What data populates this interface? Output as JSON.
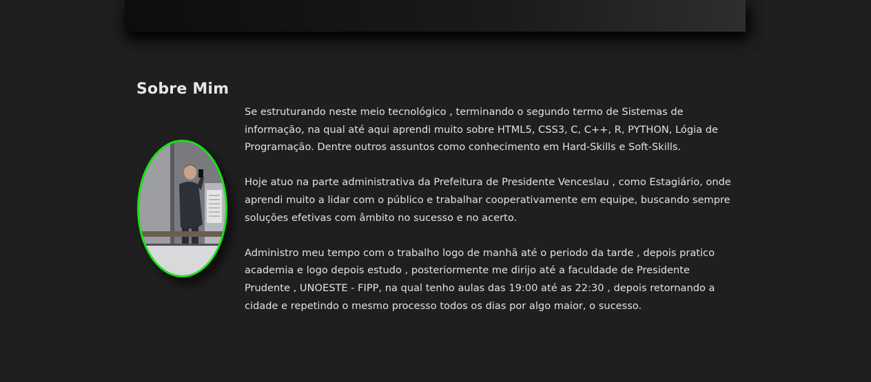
{
  "banner": {
    "gradient_start": "#0d0d0d",
    "gradient_end": "#2e2e2e"
  },
  "about": {
    "title": "Sobre Mim",
    "avatar_icon": "person-photo",
    "avatar_border_color": "#14e614",
    "paragraphs": [
      "Se estruturando neste meio tecnológico , terminando o segundo termo de Sistemas de informação, na qual até aqui aprendi muito sobre HTML5, CSS3, C, C++, R, PYTHON, Lógia de Programação. Dentre outros assuntos como conhecimento em Hard-Skills e Soft-Skills.",
      "Hoje atuo na parte administrativa da Prefeitura de Presidente Venceslau , como Estagiário, onde aprendi muito a lidar com o público e trabalhar cooperativamente em equipe, buscando sempre soluções efetivas com âmbito no sucesso e no acerto.",
      "Administro meu tempo com o trabalho logo de manhã até o periodo da tarde , depois pratico academia e logo depois estudo , posteriormente me dirijo até a faculdade de Presidente Prudente , UNOESTE - FIPP, na qual tenho aulas das 19:00 até as 22:30 , depois retornando a cidade e repetindo o mesmo processo todos os dias por algo maior, o sucesso."
    ]
  },
  "theme": {
    "background": "#1f1f1f",
    "text": "#e2e2e2"
  }
}
